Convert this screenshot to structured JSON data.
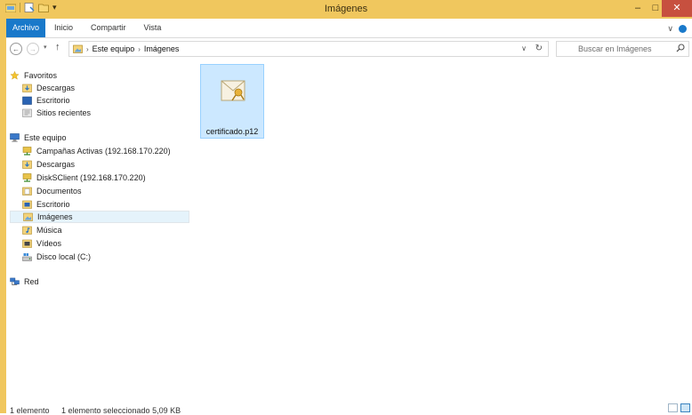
{
  "window": {
    "title": "Imágenes",
    "min_glyph": "–",
    "max_glyph": "□",
    "close_glyph": "✕",
    "qat_dropdown_glyph": "▾"
  },
  "ribbon": {
    "tabs": [
      {
        "label": "Archivo",
        "active": true
      },
      {
        "label": "Inicio"
      },
      {
        "label": "Compartir"
      },
      {
        "label": "Vista"
      }
    ],
    "collapse_glyph": "∨"
  },
  "address": {
    "back_glyph": "←",
    "forward_glyph": "→",
    "recent_glyph": "▾",
    "up_glyph": "↑",
    "separator": "›",
    "crumbs": [
      "Este equipo",
      "Imágenes"
    ],
    "dropdown_glyph": "∨",
    "refresh_glyph": "↻"
  },
  "search": {
    "placeholder": "Buscar en Imágenes"
  },
  "nav": {
    "favorites": {
      "label": "Favoritos",
      "items": [
        {
          "label": "Descargas",
          "icon": "downloads-folder-icon"
        },
        {
          "label": "Escritorio",
          "icon": "desktop-folder-icon"
        },
        {
          "label": "Sitios recientes",
          "icon": "recent-places-icon"
        }
      ]
    },
    "this_pc": {
      "label": "Este equipo",
      "items": [
        {
          "label": "Campañas Activas (192.168.170.220)",
          "icon": "network-drive-icon"
        },
        {
          "label": "Descargas",
          "icon": "downloads-folder-icon"
        },
        {
          "label": "DiskSClient (192.168.170.220)",
          "icon": "network-drive-icon"
        },
        {
          "label": "Documentos",
          "icon": "documents-folder-icon"
        },
        {
          "label": "Escritorio",
          "icon": "desktop-folder-icon"
        },
        {
          "label": "Imágenes",
          "icon": "pictures-folder-icon",
          "selected": true
        },
        {
          "label": "Música",
          "icon": "music-folder-icon"
        },
        {
          "label": "Vídeos",
          "icon": "videos-folder-icon"
        },
        {
          "label": "Disco local (C:)",
          "icon": "local-disk-icon"
        }
      ]
    },
    "network": {
      "label": "Red"
    }
  },
  "content": {
    "files": [
      {
        "name": "certificado.p12",
        "icon": "certificate-file-icon",
        "selected": true
      }
    ]
  },
  "status": {
    "count": "1 elemento",
    "selection": "1 elemento seleccionado  5,09 KB"
  },
  "colors": {
    "title_bar": "#f0c75e",
    "file_tab": "#1979ca",
    "close_button": "#c7503f",
    "selection_fill": "#cce8ff"
  }
}
